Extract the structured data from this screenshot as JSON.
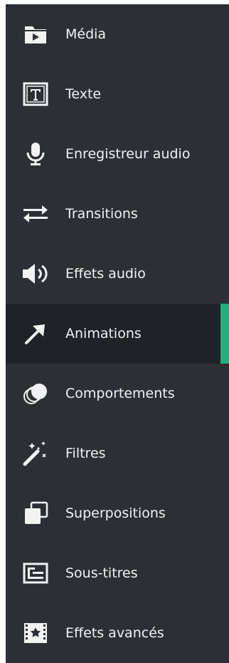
{
  "colors": {
    "panel_bg": "#2c3035",
    "active_bg": "#1f2226",
    "accent": "#21b07e",
    "text": "#f2f2f2"
  },
  "sidebar": {
    "active_index": 5,
    "items": [
      {
        "label": "Média",
        "icon": "media-folder-icon"
      },
      {
        "label": "Texte",
        "icon": "text-icon"
      },
      {
        "label": "Enregistreur audio",
        "icon": "microphone-icon"
      },
      {
        "label": "Transitions",
        "icon": "transition-arrows-icon"
      },
      {
        "label": "Effets audio",
        "icon": "speaker-icon"
      },
      {
        "label": "Animations",
        "icon": "arrow-icon"
      },
      {
        "label": "Comportements",
        "icon": "behaviors-icon"
      },
      {
        "label": "Filtres",
        "icon": "magic-wand-icon"
      },
      {
        "label": "Superpositions",
        "icon": "overlay-icon"
      },
      {
        "label": "Sous-titres",
        "icon": "subtitles-icon"
      },
      {
        "label": "Effets avancés",
        "icon": "advanced-effects-icon"
      }
    ]
  }
}
